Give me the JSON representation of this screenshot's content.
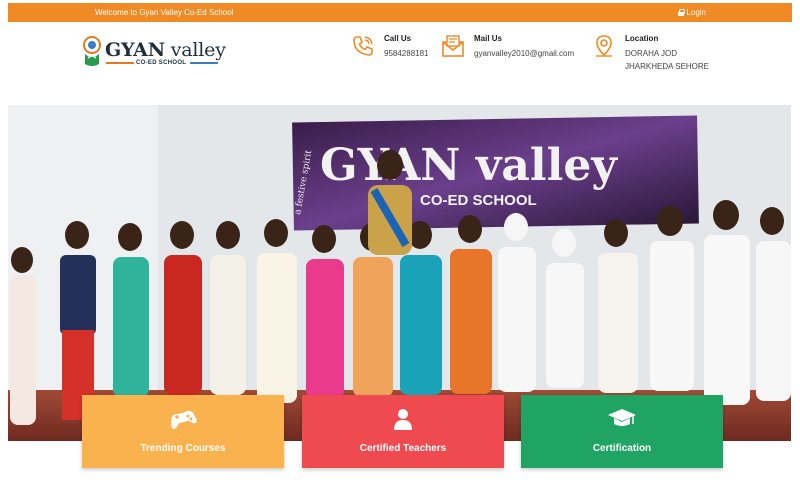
{
  "topbar": {
    "welcome": "Welcome to Gyan Valley Co-Ed School",
    "login": "Login",
    "bg": "#f08a24"
  },
  "logo": {
    "name_bold": "GYAN",
    "name_rest": " valley",
    "tagline": "CO-ED SCHOOL"
  },
  "contacts": [
    {
      "label": "Call Us",
      "value": "9584288181",
      "icon": "phone-icon"
    },
    {
      "label": "Mail Us",
      "value": "gyanvalley2010@gmail.com",
      "icon": "envelope-icon"
    },
    {
      "label": "Location",
      "value_line1": "DORAHA JOD",
      "value_line2": "JHARKHEDA SEHORE",
      "icon": "location-pin-icon"
    }
  ],
  "hero": {
    "banner_title": "GYAN valley",
    "banner_sub": "CO-ED SCHOOL",
    "banner_side": "a festive spirit"
  },
  "features": [
    {
      "label": "Trending Courses",
      "icon": "gamepad-icon",
      "color": "#f9b24e"
    },
    {
      "label": "Certified Teachers",
      "icon": "teacher-icon",
      "color": "#ee4a4f"
    },
    {
      "label": "Certification",
      "icon": "graduation-cap-icon",
      "color": "#1fa463"
    }
  ],
  "colors": {
    "accent": "#f08a24",
    "text_dark": "#1f2f3d"
  }
}
